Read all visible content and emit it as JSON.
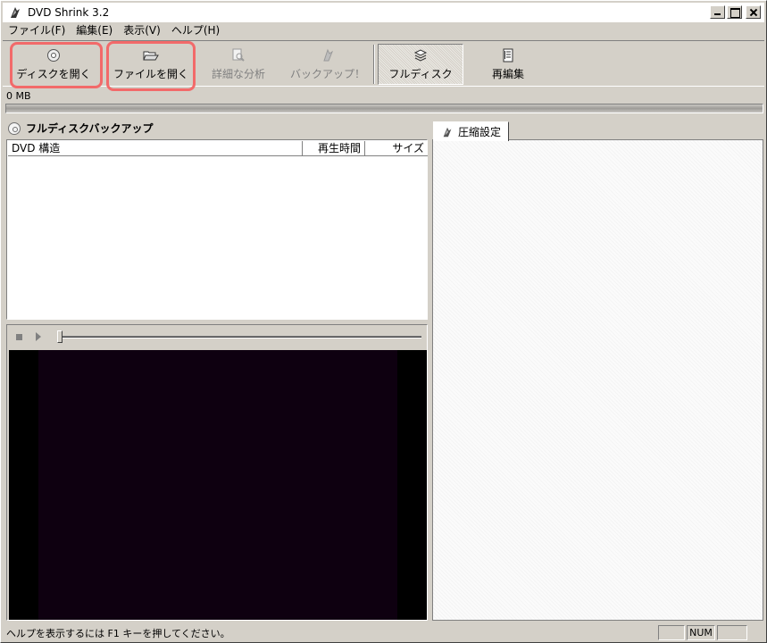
{
  "window": {
    "title": "DVD Shrink 3.2"
  },
  "menu": [
    {
      "label": "ファイル(F)"
    },
    {
      "label": "編集(E)"
    },
    {
      "label": "表示(V)"
    },
    {
      "label": "ヘルプ(H)"
    }
  ],
  "toolbar": {
    "open_disc": "ディスクを開く",
    "open_files": "ファイルを開く",
    "re_analyze": "詳細な分析",
    "backup": "バックアップ！",
    "full_disc": "フルディスク",
    "re_author": "再編集"
  },
  "size": {
    "label": "0 MB",
    "fill_fraction": 0
  },
  "backup_panel": {
    "title": "フルディスクバックアップ",
    "columns": [
      "DVD 構造",
      "再生時間",
      "サイズ"
    ]
  },
  "tab": {
    "label": "圧縮設定"
  },
  "status": {
    "text": "ヘルプを表示するには F1 キーを押してください。",
    "indicators": [
      "",
      "NUM",
      ""
    ]
  },
  "colors": {
    "highlight": "#f26a6a",
    "video_bg": "#0e0010"
  }
}
